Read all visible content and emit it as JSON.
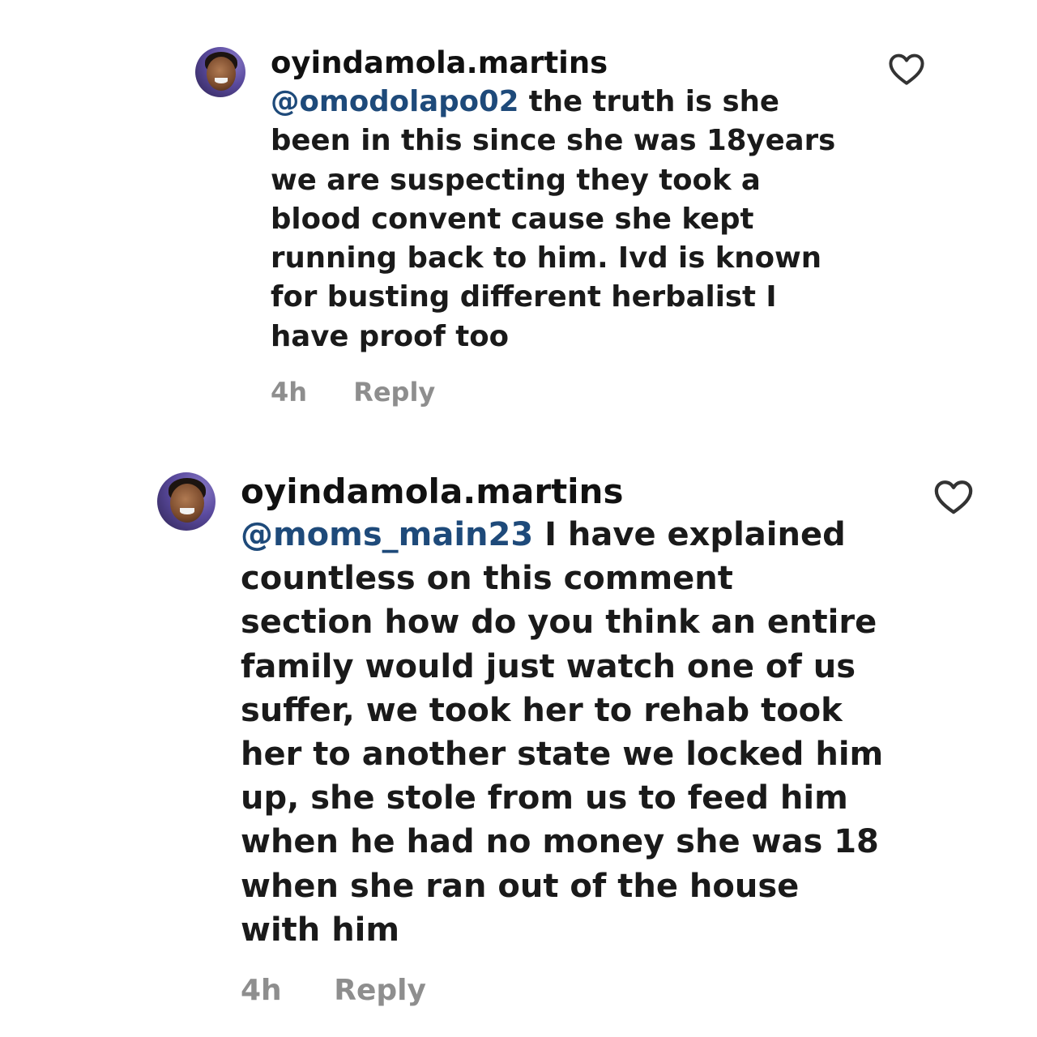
{
  "comments": [
    {
      "username": "oyindamola.martins",
      "mention": "@omodolapo02",
      "lines": [
        " the truth is she",
        "been in this since she was 18years",
        "we are suspecting they took a",
        "blood convent cause she kept",
        "running back to him. Ivd is known",
        "for busting different herbalist I",
        "have proof too"
      ],
      "time": "4h",
      "reply_label": "Reply",
      "like_icon": "heart-outline-icon"
    },
    {
      "username": "oyindamola.martins",
      "mention": "@moms_main23",
      "lines": [
        " I have explained",
        "countless on this comment",
        "section how do you think an entire",
        "family would just watch one of us",
        "suffer, we took her to rehab took",
        "her to another state we locked him",
        "up, she stole from us to feed him",
        "when he had no money she was 18",
        "when she ran out of the house",
        "with him"
      ],
      "time": "4h",
      "reply_label": "Reply",
      "like_icon": "heart-outline-icon"
    }
  ],
  "colors": {
    "mention": "#1e4a7a",
    "text": "#1a1a1a",
    "meta": "#8e8e8e",
    "icon": "#333333"
  }
}
